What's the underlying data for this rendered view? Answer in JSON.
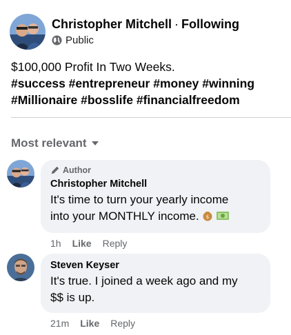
{
  "post": {
    "author_name": "Christopher Mitchell",
    "separator": "·",
    "follow_status": "Following",
    "privacy": "Public",
    "text": "$100,000 Profit In Two Weeks.",
    "hashtags_line1": "#success #entrepreneur #money #winning",
    "hashtags_line2": "#Millionaire #bosslife #financialfreedom"
  },
  "comments_section": {
    "sort_label": "Most relevant"
  },
  "comments": [
    {
      "badge": "Author",
      "name": "Christopher Mitchell",
      "text_line1": "It's time to turn your yearly income",
      "text_line2": "into your MONTHLY income.",
      "time": "1h",
      "like": "Like",
      "reply": "Reply"
    },
    {
      "name": "Steven Keyser",
      "text_line1": "It's true. I joined a week ago and my",
      "text_line2": "$$ is up.",
      "time": "21m",
      "like": "Like",
      "reply": "Reply"
    }
  ],
  "colors": {
    "secondary_text": "#65676b",
    "bubble": "#f0f2f5",
    "divider": "#ced0d4"
  }
}
